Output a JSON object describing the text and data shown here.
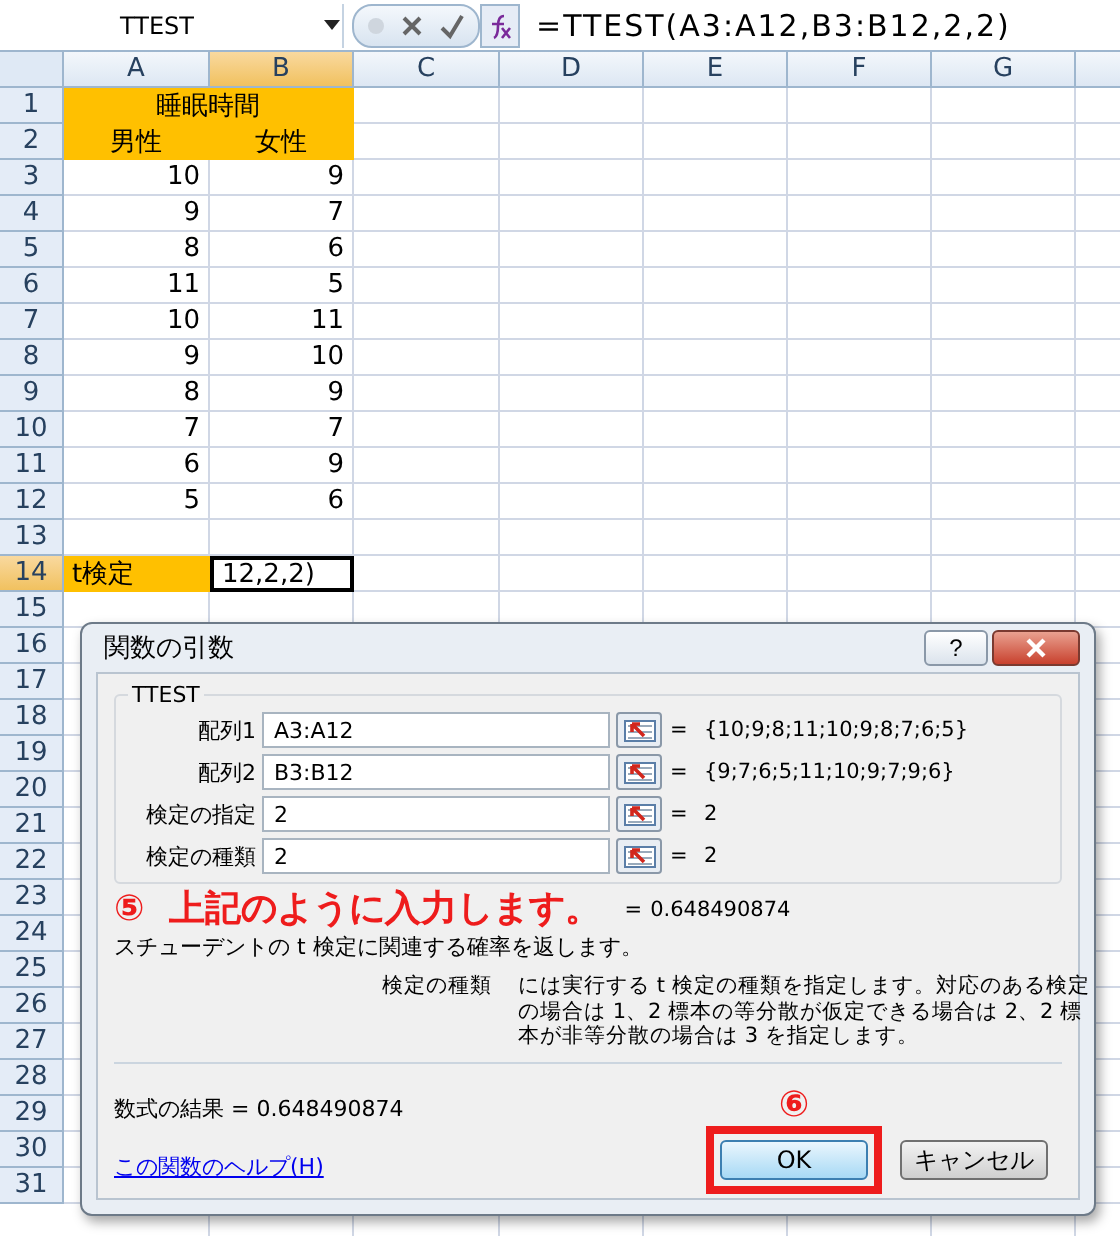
{
  "formula_bar": {
    "name_box": "TTEST",
    "formula": "=TTEST(A3:A12,B3:B12,2,2)"
  },
  "columns": [
    {
      "label": "A",
      "selected": false
    },
    {
      "label": "B",
      "selected": true
    },
    {
      "label": "C",
      "selected": false
    },
    {
      "label": "D",
      "selected": false
    },
    {
      "label": "E",
      "selected": false
    },
    {
      "label": "F",
      "selected": false
    },
    {
      "label": "G",
      "selected": false
    }
  ],
  "rows": [
    {
      "header": "1",
      "selected": false,
      "cells": [
        {
          "text": "睡眠時間",
          "kind": "merged"
        }
      ]
    },
    {
      "header": "2",
      "selected": false,
      "cells": [
        {
          "text": "男性",
          "kind": "heading"
        },
        {
          "text": "女性",
          "kind": "heading"
        }
      ]
    },
    {
      "header": "3",
      "selected": false,
      "cells": [
        {
          "text": "10",
          "kind": "number"
        },
        {
          "text": "9",
          "kind": "number"
        }
      ]
    },
    {
      "header": "4",
      "selected": false,
      "cells": [
        {
          "text": "9",
          "kind": "number"
        },
        {
          "text": "7",
          "kind": "number"
        }
      ]
    },
    {
      "header": "5",
      "selected": false,
      "cells": [
        {
          "text": "8",
          "kind": "number"
        },
        {
          "text": "6",
          "kind": "number"
        }
      ]
    },
    {
      "header": "6",
      "selected": false,
      "cells": [
        {
          "text": "11",
          "kind": "number"
        },
        {
          "text": "5",
          "kind": "number"
        }
      ]
    },
    {
      "header": "7",
      "selected": false,
      "cells": [
        {
          "text": "10",
          "kind": "number"
        },
        {
          "text": "11",
          "kind": "number"
        }
      ]
    },
    {
      "header": "8",
      "selected": false,
      "cells": [
        {
          "text": "9",
          "kind": "number"
        },
        {
          "text": "10",
          "kind": "number"
        }
      ]
    },
    {
      "header": "9",
      "selected": false,
      "cells": [
        {
          "text": "8",
          "kind": "number"
        },
        {
          "text": "9",
          "kind": "number"
        }
      ]
    },
    {
      "header": "10",
      "selected": false,
      "cells": [
        {
          "text": "7",
          "kind": "number"
        },
        {
          "text": "7",
          "kind": "number"
        }
      ]
    },
    {
      "header": "11",
      "selected": false,
      "cells": [
        {
          "text": "6",
          "kind": "number"
        },
        {
          "text": "9",
          "kind": "number"
        }
      ]
    },
    {
      "header": "12",
      "selected": false,
      "cells": [
        {
          "text": "5",
          "kind": "number"
        },
        {
          "text": "6",
          "kind": "number"
        }
      ]
    },
    {
      "header": "13",
      "selected": false,
      "cells": []
    },
    {
      "header": "14",
      "selected": true,
      "cells": [
        {
          "text": "t検定",
          "kind": "label"
        },
        {
          "text": "12,2,2)",
          "kind": "active"
        }
      ]
    },
    {
      "header": "15",
      "selected": false,
      "cells": []
    },
    {
      "header": "16",
      "selected": false,
      "cells": []
    },
    {
      "header": "17",
      "selected": false,
      "cells": []
    },
    {
      "header": "18",
      "selected": false,
      "cells": []
    },
    {
      "header": "19",
      "selected": false,
      "cells": []
    },
    {
      "header": "20",
      "selected": false,
      "cells": []
    },
    {
      "header": "21",
      "selected": false,
      "cells": []
    },
    {
      "header": "22",
      "selected": false,
      "cells": []
    },
    {
      "header": "23",
      "selected": false,
      "cells": []
    },
    {
      "header": "24",
      "selected": false,
      "cells": []
    },
    {
      "header": "25",
      "selected": false,
      "cells": []
    },
    {
      "header": "26",
      "selected": false,
      "cells": []
    },
    {
      "header": "27",
      "selected": false,
      "cells": []
    },
    {
      "header": "28",
      "selected": false,
      "cells": []
    },
    {
      "header": "29",
      "selected": false,
      "cells": []
    },
    {
      "header": "30",
      "selected": false,
      "cells": []
    },
    {
      "header": "31",
      "selected": false,
      "cells": []
    }
  ],
  "dialog": {
    "title": "関数の引数",
    "help_button": "?",
    "function_name": "TTEST",
    "arguments": [
      {
        "label": "配列1",
        "value": "A3:A12",
        "equals": "=",
        "result": "{10;9;8;11;10;9;8;7;6;5}"
      },
      {
        "label": "配列2",
        "value": "B3:B12",
        "equals": "=",
        "result": "{9;7;6;5;11;10;9;7;9;6}"
      },
      {
        "label": "検定の指定",
        "value": "2",
        "equals": "=",
        "result": "2"
      },
      {
        "label": "検定の種類",
        "value": "2",
        "equals": "=",
        "result": "2"
      }
    ],
    "annotation_5": {
      "number": "⑤",
      "text": "上記のように入力します。"
    },
    "result_equals": "=",
    "result": "0.648490874",
    "description": "スチューデントの t 検定に関連する確率を返します。",
    "param_name": "検定の種類",
    "param_help": "には実行する t 検定の種類を指定します。対応のある検定の場合は 1、2 標本の等分散が仮定できる場合は 2、2 標本が非等分散の場合は 3 を指定します。",
    "formula_result_label": "数式の結果 =",
    "formula_result": "0.648490874",
    "help_link": "この関数のヘルプ(H)",
    "annotation_6": "⑥",
    "buttons": [
      {
        "label": "OK",
        "highlighted": true
      },
      {
        "label": "キャンセル",
        "highlighted": false
      }
    ]
  }
}
